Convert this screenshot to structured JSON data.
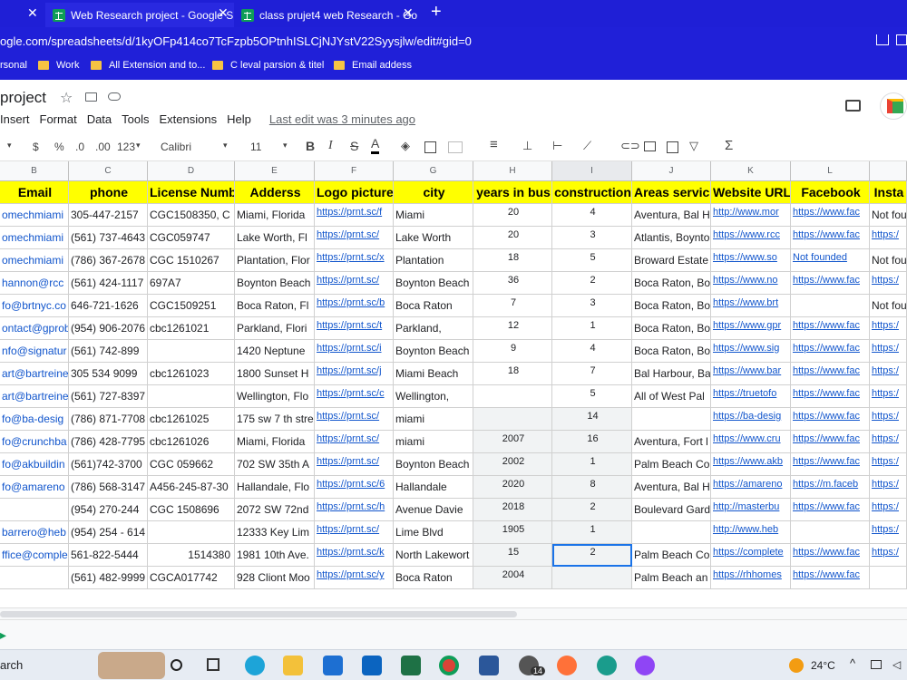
{
  "browser": {
    "tabs": [
      {
        "title": "Web Research project - Google S"
      },
      {
        "title": "class prujet4 web Research - Goo"
      }
    ],
    "new_tab": "+",
    "url": "ogle.com/spreadsheets/d/1kyOFp414co7TcFzpb5OPtnhISLCjNJYstV22Syysjlw/edit#gid=0",
    "bookmarks": [
      "rsonal",
      "Work",
      "All Extension and to...",
      "C leval parsion & titel",
      "Email addess"
    ]
  },
  "doc": {
    "title": "project",
    "menus": [
      "Insert",
      "Format",
      "Data",
      "Tools",
      "Extensions",
      "Help"
    ],
    "last_edit": "Last edit was 3 minutes ago"
  },
  "toolbar": {
    "currency": "$",
    "percent": "%",
    "dec_less": ".0",
    "dec_more": ".00",
    "format": "123",
    "font": "Calibri",
    "size": "11",
    "bold": "B",
    "italic": "I",
    "strike": "S",
    "textcolor": "A",
    "sigma": "Σ"
  },
  "columns": [
    "B",
    "C",
    "D",
    "E",
    "F",
    "G",
    "H",
    "I",
    "J",
    "K",
    "L",
    ""
  ],
  "headers": [
    "Email",
    "phone",
    "License Numb",
    "Adderss",
    "Logo picture",
    "city",
    "years in bus",
    "construction",
    "Areas servici",
    "Website URL",
    "Facebook",
    "Insta"
  ],
  "rows": [
    [
      "omechmiami",
      "305-447-2157",
      " CGC1508350, C",
      "Miami, Florida",
      "https://prnt.sc/f",
      "Miami",
      "20",
      "4",
      "Aventura, Bal H",
      "http://www.mor",
      "https://www.fac",
      "Not fou"
    ],
    [
      "omechmiami",
      "(561) 737-4643",
      "CGC059747",
      "Lake Worth, Fl",
      "https://prnt.sc/",
      "Lake Worth",
      "20",
      "3",
      "Atlantis, Boynto",
      "https://www.rcc",
      "https://www.fac",
      "https:/"
    ],
    [
      "omechmiami",
      "(786) 367-2678",
      " CGC 1510267",
      "Plantation, Flor",
      "https://prnt.sc/x",
      "Plantation",
      "18",
      "5",
      "Broward Estate",
      "https://www.so",
      "Not founded",
      "Not fou"
    ],
    [
      "hannon@rcc",
      "(561) 424-1117",
      "697A7",
      "Boynton Beach",
      "https://prnt.sc/",
      "Boynton Beach",
      "36",
      "2",
      "Boca Raton, Bo",
      "https://www.no",
      "https://www.fac",
      "https:/"
    ],
    [
      "fo@brtnyc.co",
      "646-721-1626",
      "CGC1509251",
      "Boca Raton, Fl",
      "https://prnt.sc/b",
      "Boca Raton",
      "7",
      "3",
      "Boca Raton, Bo",
      "https://www.brt",
      "",
      "Not fou"
    ],
    [
      "ontact@gprob",
      "(954) 906-2076",
      "cbc1261021",
      "Parkland, Flori",
      "https://prnt.sc/t",
      "Parkland,",
      "12",
      "1",
      "Boca Raton, Bo",
      "https://www.gpr",
      "https://www.fac",
      "https:/"
    ],
    [
      "nfo@signatur",
      " (561) 742-899",
      "",
      "1420 Neptune",
      "https://prnt.sc/i",
      "Boynton Beach",
      "9",
      "4",
      "Boca Raton, Bo",
      "https://www.sig",
      "https://www.fac",
      "https:/"
    ],
    [
      "art@bartreine",
      "305 534 9099",
      "cbc1261023",
      "1800 Sunset H",
      "https://prnt.sc/j",
      "Miami Beach",
      "18",
      "7",
      "Bal Harbour, Ba",
      "https://www.bar",
      "https://www.fac",
      "https:/"
    ],
    [
      "art@bartreine",
      "(561) 727-8397",
      "",
      "Wellington, Flo",
      "https://prnt.sc/c",
      "Wellington,",
      "",
      "5",
      "All of West Pal",
      "https://truetofo",
      "https://www.fac",
      "https:/"
    ],
    [
      "fo@ba-desig",
      "(786) 871-7708",
      "cbc1261025",
      "175 sw 7 th stree",
      "https://prnt.sc/",
      "miami",
      "",
      "14",
      "",
      "https://ba-desig",
      "https://www.fac",
      "https:/"
    ],
    [
      "fo@crunchba",
      "(786) 428-7795",
      "cbc1261026",
      "Miami, Florida",
      "https://prnt.sc/",
      "miami",
      "2007",
      "16",
      "Aventura, Fort l",
      "https://www.cru",
      "https://www.fac",
      "https:/"
    ],
    [
      "fo@akbuildin",
      "(561)742-3700",
      "CGC 059662",
      "702 SW 35th A",
      "https://prnt.sc/",
      "Boynton Beach",
      "2002",
      "1",
      "Palm Beach Co",
      "https://www.akb",
      "https://www.fac",
      "https:/"
    ],
    [
      "fo@amareno",
      "(786) 568-3147",
      "A456-245-87-30",
      "Hallandale, Flo",
      "https://prnt.sc/6",
      "Hallandale",
      "2020",
      "8",
      "Aventura, Bal H",
      "https://amareno",
      "https://m.faceb",
      "https:/"
    ],
    [
      "",
      " (954) 270-244",
      "CGC 1508696",
      "2072 SW 72nd",
      "https://prnt.sc/h",
      "Avenue Davie",
      "2018",
      "2",
      "Boulevard Gard",
      "http://masterbu",
      "https://www.fac",
      "https:/"
    ],
    [
      "barrero@heb",
      "(954) 254 - 614",
      "",
      "12333 Key Lim",
      "https://prnt.sc/",
      "Lime Blvd",
      "1905",
      "1",
      "",
      "http://www.heb",
      "",
      "https:/"
    ],
    [
      "ffice@comple",
      "561-822-5444",
      "1514380",
      "1981 10th Ave.",
      "https://prnt.sc/k",
      "North Lakewort",
      "15",
      "2",
      "Palm Beach Co",
      "https://complete",
      "https://www.fac",
      "https:/"
    ],
    [
      "",
      "(561) 482-9999",
      "CGCA017742",
      "928 Cliont Moo",
      "https://prnt.sc/y",
      "Boca Raton",
      "2004",
      "",
      "Palm Beach an",
      "https://rhhomes",
      "https://www.fac",
      ""
    ]
  ],
  "taskbar": {
    "search": "arch",
    "temperature": "24°C",
    "badge": "14"
  }
}
